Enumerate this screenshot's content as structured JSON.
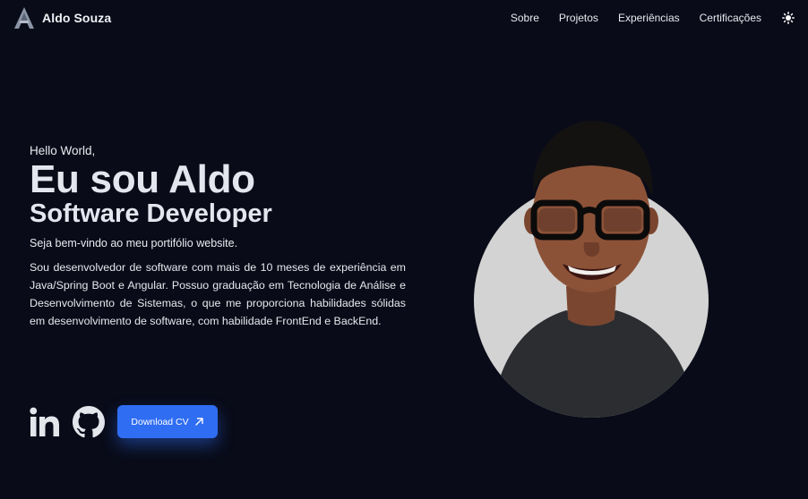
{
  "header": {
    "brand_name": "Aldo Souza",
    "nav": [
      "Sobre",
      "Projetos",
      "Experiências",
      "Certificações"
    ],
    "theme_icon": "sun-icon"
  },
  "hero": {
    "greeting": "Hello World,",
    "title": "Eu sou Aldo",
    "subtitle": "Software Developer",
    "welcome": "Seja bem-vindo ao meu portifólio website.",
    "description": "Sou desenvolvedor de software com mais de 10 meses de experiência em Java/Spring Boot e Angular. Possuo graduação em Tecnologia de Análise e Desenvolvimento de Sistemas, o que me proporciona habilidades sólidas em desenvolvimento de software, com habilidade FrontEnd e BackEnd."
  },
  "socials": {
    "icons": [
      "linkedin-icon",
      "github-icon"
    ],
    "cv_button_label": "Download CV",
    "cv_button_icon": "arrow-up-right-icon"
  },
  "colors": {
    "background": "#090b18",
    "accent": "#2f6df2",
    "text": "#e6e8ee"
  }
}
